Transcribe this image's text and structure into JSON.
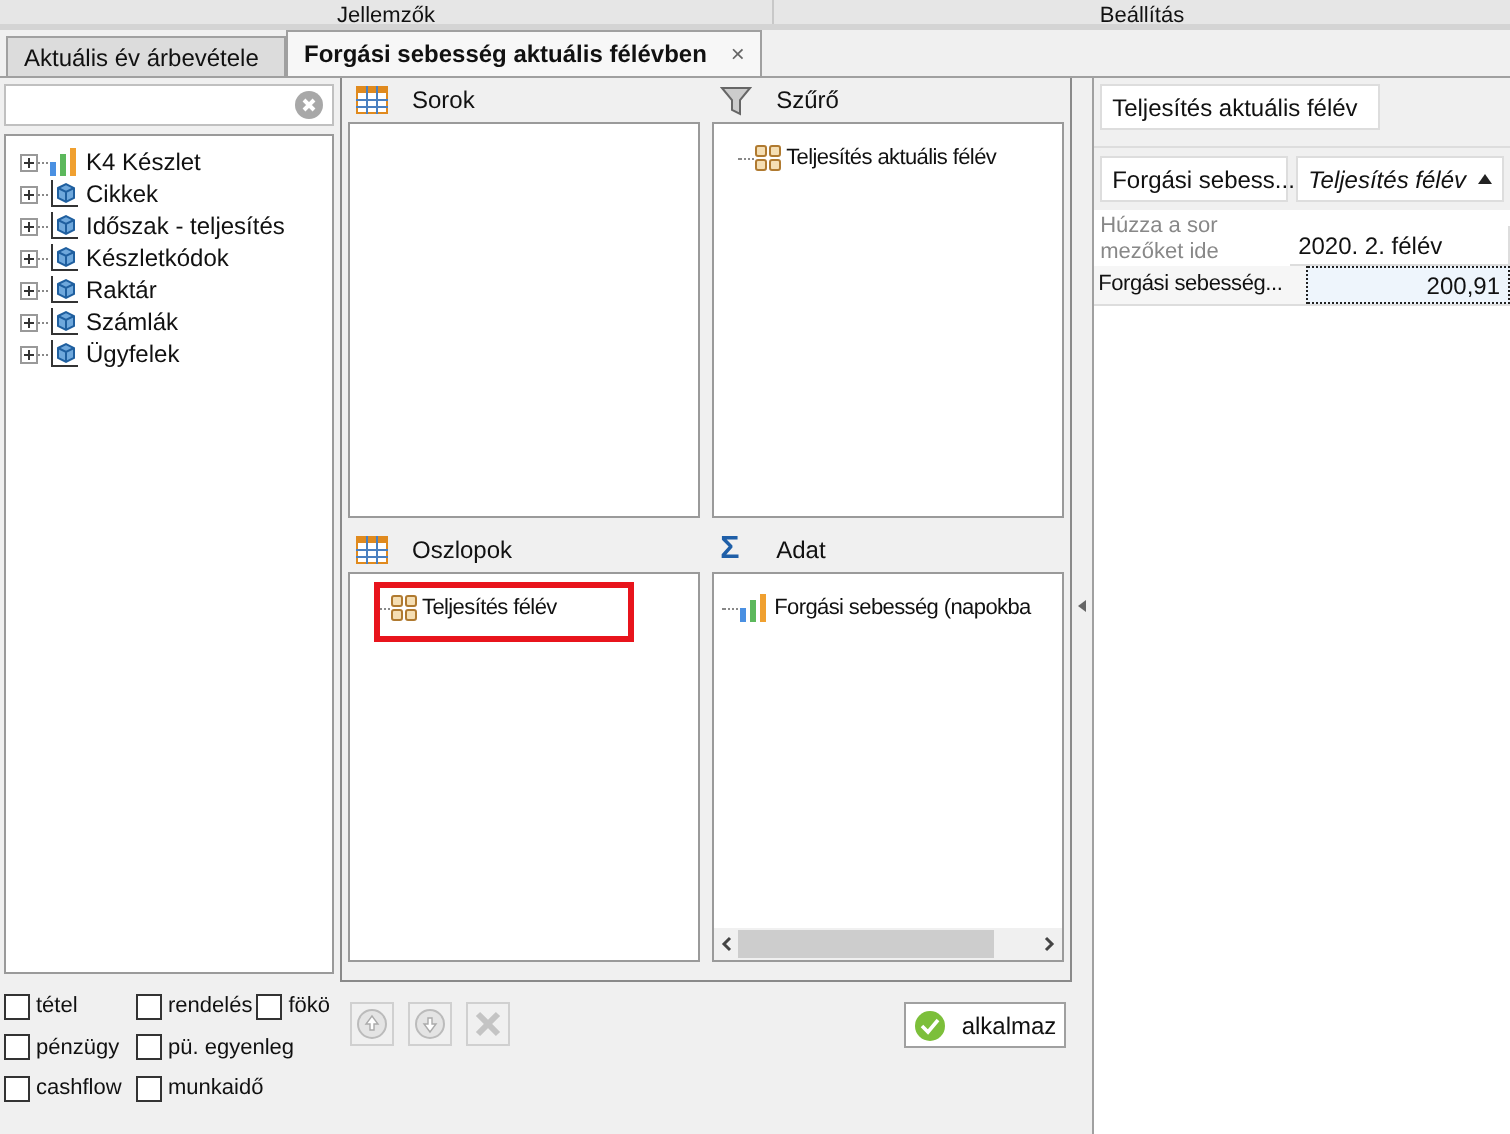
{
  "header": {
    "left": "Jellemzők",
    "right": "Beállítás"
  },
  "tabs": [
    {
      "label": "Aktuális év árbevétele",
      "selected": false
    },
    {
      "label": "Forgási sebesség aktuális félévben",
      "selected": true,
      "close": "×"
    }
  ],
  "tree": [
    {
      "label": "K4 Készlet",
      "kind": "measure"
    },
    {
      "label": "Cikkek",
      "kind": "dimension"
    },
    {
      "label": "Időszak - teljesítés",
      "kind": "dimension"
    },
    {
      "label": "Készletkódok",
      "kind": "dimension"
    },
    {
      "label": "Raktár",
      "kind": "dimension"
    },
    {
      "label": "Számlák",
      "kind": "dimension"
    },
    {
      "label": "Ügyfelek",
      "kind": "dimension"
    }
  ],
  "checkboxes": [
    [
      {
        "label": "tétel",
        "checked": false
      },
      {
        "label": "rendelés",
        "checked": false
      },
      {
        "label": "fökö",
        "checked": false
      }
    ],
    [
      {
        "label": "pénzügy",
        "checked": false
      },
      {
        "label": "pü. egyenleg",
        "checked": false
      }
    ],
    [
      {
        "label": "cashflow",
        "checked": false
      },
      {
        "label": "munkaidő",
        "checked": false
      }
    ]
  ],
  "zones": [
    {
      "title": "Sorok",
      "kind": "rows"
    },
    {
      "title": "Szűrő",
      "kind": "filter",
      "fields": [
        {
          "label": "Teljesítés aktuális félév",
          "kind": "dimension",
          "highlighted": false
        }
      ]
    },
    {
      "title": "Oszlopok",
      "kind": "columns",
      "fields": [
        {
          "label": "Teljesítés félév",
          "kind": "dimension",
          "highlighted": true
        }
      ]
    },
    {
      "title": "Adat",
      "kind": "data",
      "icon": "Σ",
      "fields": [
        {
          "label": "Forgási sebesség (napokba",
          "kind": "measure",
          "highlighted": false
        }
      ]
    }
  ],
  "apply_button": "alkalmaz",
  "preview": {
    "filter_button": "Teljesítés aktuális félév",
    "data_header": "Forgási sebess...",
    "column_header": "Teljesítés félév",
    "row_hint": "Húzza a sor mezőket ide",
    "column_value": "2020. 2. félév",
    "row_label": "Forgási sebesség...",
    "cell": "200,91"
  }
}
